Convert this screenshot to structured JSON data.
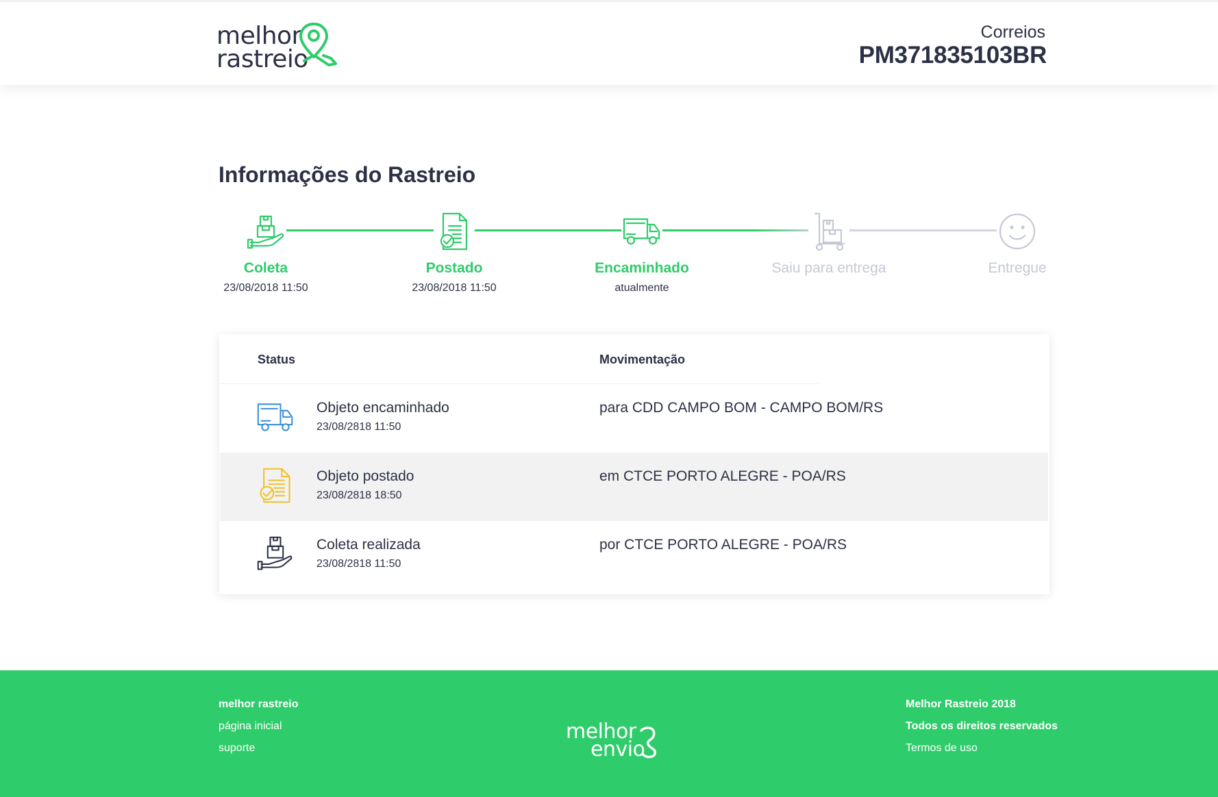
{
  "header": {
    "logo_line1": "melhor",
    "logo_line2": "rastreio",
    "carrier": "Correios",
    "tracking_code": "PM371835103BR"
  },
  "page": {
    "title": "Informações do Rastreio"
  },
  "steps": [
    {
      "label": "Coleta",
      "date": "23/08/2018 11:50",
      "state": "done",
      "icon": "package-hand-icon"
    },
    {
      "label": "Postado",
      "date": "23/08/2018 11:50",
      "state": "done",
      "icon": "document-check-icon"
    },
    {
      "label": "Encaminhado",
      "date": "atualmente",
      "state": "done",
      "icon": "truck-icon"
    },
    {
      "label": "Saiu para entrega",
      "date": "",
      "state": "todo",
      "icon": "hand-truck-icon"
    },
    {
      "label": "Entregue",
      "date": "",
      "state": "todo",
      "icon": "smiley-icon"
    }
  ],
  "table": {
    "col_status": "Status",
    "col_movement": "Movimentação",
    "rows": [
      {
        "status": "Objeto encaminhado",
        "date": "23/08/2818 11:50",
        "movement": "para CDD CAMPO BOM - CAMPO BOM/RS",
        "icon": "truck-icon",
        "icon_color": "#3b8fd9"
      },
      {
        "status": "Objeto postado",
        "date": "23/08/2818 18:50",
        "movement": "em CTCE PORTO ALEGRE - POA/RS",
        "icon": "document-check-icon",
        "icon_color": "#f2c025"
      },
      {
        "status": "Coleta realizada",
        "date": "23/08/2818 11:50",
        "movement": "por CTCE PORTO ALEGRE - POA/RS",
        "icon": "package-hand-icon",
        "icon_color": "#2b3045"
      }
    ]
  },
  "footer": {
    "left_title": "melhor rastreio",
    "left_link1": "página inicial",
    "left_link2": "suporte",
    "logo_line1": "melhor",
    "logo_line2": "envio",
    "right_line1": "Melhor Rastreio 2018",
    "right_line2": "Todos os direitos reservados",
    "right_link": "Termos de uso"
  },
  "colors": {
    "accent": "#2ecc6a",
    "text": "#2b3045",
    "muted": "#c5c9d6",
    "truck_blue": "#3b8fd9",
    "doc_yellow": "#f2c025"
  }
}
